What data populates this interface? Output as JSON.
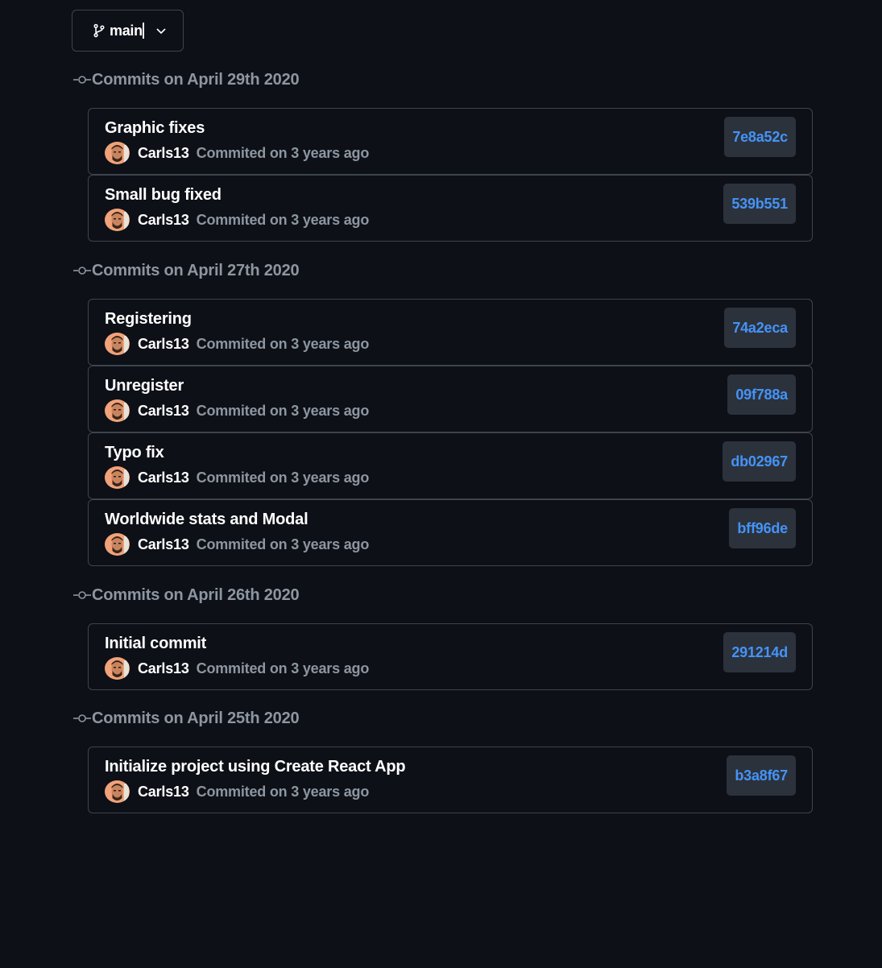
{
  "branch": {
    "name": "main",
    "icon": "git-branch-icon",
    "dropdown_icon": "chevron-down-icon"
  },
  "groups": [
    {
      "title": "Commits on April 29th 2020",
      "commits": [
        {
          "message": "Graphic fixes",
          "author": "Carls13",
          "when": "Commited on 3 years ago",
          "sha": "7e8a52c"
        },
        {
          "message": "Small bug fixed",
          "author": "Carls13",
          "when": "Commited on 3 years ago",
          "sha": "539b551"
        }
      ]
    },
    {
      "title": "Commits on April 27th 2020",
      "commits": [
        {
          "message": "Registering",
          "author": "Carls13",
          "when": "Commited on 3 years ago",
          "sha": "74a2eca"
        },
        {
          "message": "Unregister",
          "author": "Carls13",
          "when": "Commited on 3 years ago",
          "sha": "09f788a"
        },
        {
          "message": "Typo fix",
          "author": "Carls13",
          "when": "Commited on 3 years ago",
          "sha": "db02967"
        },
        {
          "message": "Worldwide stats and Modal",
          "author": "Carls13",
          "when": "Commited on 3 years ago",
          "sha": "bff96de"
        }
      ]
    },
    {
      "title": "Commits on April 26th 2020",
      "commits": [
        {
          "message": "Initial commit",
          "author": "Carls13",
          "when": "Commited on 3 years ago",
          "sha": "291214d"
        }
      ]
    },
    {
      "title": "Commits on April 25th 2020",
      "commits": [
        {
          "message": "Initialize project using Create React App",
          "author": "Carls13",
          "when": "Commited on 3 years ago",
          "sha": "b3a8f67"
        }
      ]
    }
  ],
  "colors": {
    "background": "#0d1017",
    "border": "#3d444d",
    "muted_text": "#8d96a0",
    "sha_link": "#4493f8",
    "sha_bg": "#2c323b"
  }
}
